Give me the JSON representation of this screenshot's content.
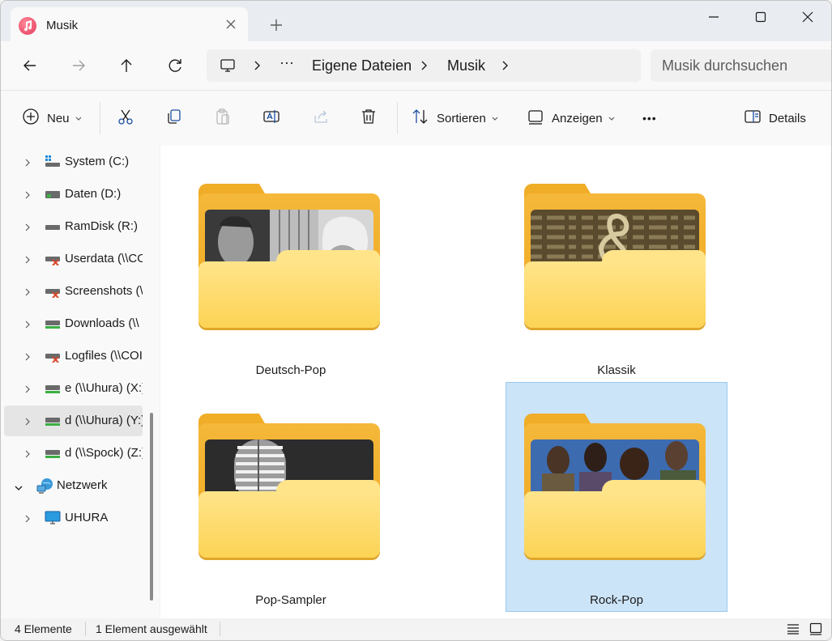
{
  "window": {
    "tab_title": "Musik",
    "icons": {
      "app": "music-note-icon",
      "close_tab": "close-icon",
      "new_tab": "plus-icon",
      "minimize": "minimize-icon",
      "maximize": "maximize-icon",
      "close": "close-icon"
    }
  },
  "address_bar": {
    "breadcrumb_overflow": "···",
    "crumbs": [
      "Eigene Dateien",
      "Musik"
    ],
    "search_placeholder": "Musik durchsuchen"
  },
  "command_bar": {
    "new_label": "Neu",
    "sort_label": "Sortieren",
    "view_label": "Anzeigen",
    "more_label": "•••",
    "details_label": "Details",
    "icons": [
      "plus-circle-icon",
      "cut-icon",
      "copy-icon",
      "paste-icon",
      "rename-icon",
      "share-icon",
      "delete-icon",
      "sort-icon",
      "view-icon",
      "more-icon",
      "details-pane-icon"
    ]
  },
  "sidebar": {
    "items": [
      {
        "label": "System (C:)",
        "icon": "windows-drive-icon",
        "selected": false
      },
      {
        "label": "Daten (D:)",
        "icon": "drive-icon",
        "selected": false
      },
      {
        "label": "RamDisk (R:)",
        "icon": "drive-icon",
        "selected": false
      },
      {
        "label": "Userdata (\\\\CO",
        "icon": "disconnected-network-drive-icon",
        "selected": false
      },
      {
        "label": "Screenshots (\\\\",
        "icon": "disconnected-network-drive-icon",
        "selected": false
      },
      {
        "label": "Downloads (\\\\",
        "icon": "network-drive-icon",
        "selected": false
      },
      {
        "label": "Logfiles (\\\\COI",
        "icon": "disconnected-network-drive-icon",
        "selected": false
      },
      {
        "label": "e (\\\\Uhura) (X:)",
        "icon": "network-drive-icon",
        "selected": false
      },
      {
        "label": "d (\\\\Uhura) (Y:)",
        "icon": "network-drive-icon",
        "selected": true
      },
      {
        "label": "d (\\\\Spock) (Z:)",
        "icon": "network-drive-icon",
        "selected": false
      },
      {
        "label": "Netzwerk",
        "icon": "network-icon",
        "selected": false
      },
      {
        "label": "UHURA",
        "icon": "computer-icon",
        "selected": false
      }
    ]
  },
  "folders": [
    {
      "name": "Deutsch-Pop",
      "selected": false
    },
    {
      "name": "Klassik",
      "selected": false
    },
    {
      "name": "Pop-Sampler",
      "selected": false
    },
    {
      "name": "Rock-Pop",
      "selected": true
    }
  ],
  "status_bar": {
    "count": "4 Elemente",
    "selection": "1 Element ausgewählt",
    "icons": [
      "details-view-icon",
      "large-icons-view-icon"
    ]
  },
  "colors": {
    "selection": "#cce4f7",
    "folder": "#f5b83a",
    "accent": "#0067c0"
  }
}
